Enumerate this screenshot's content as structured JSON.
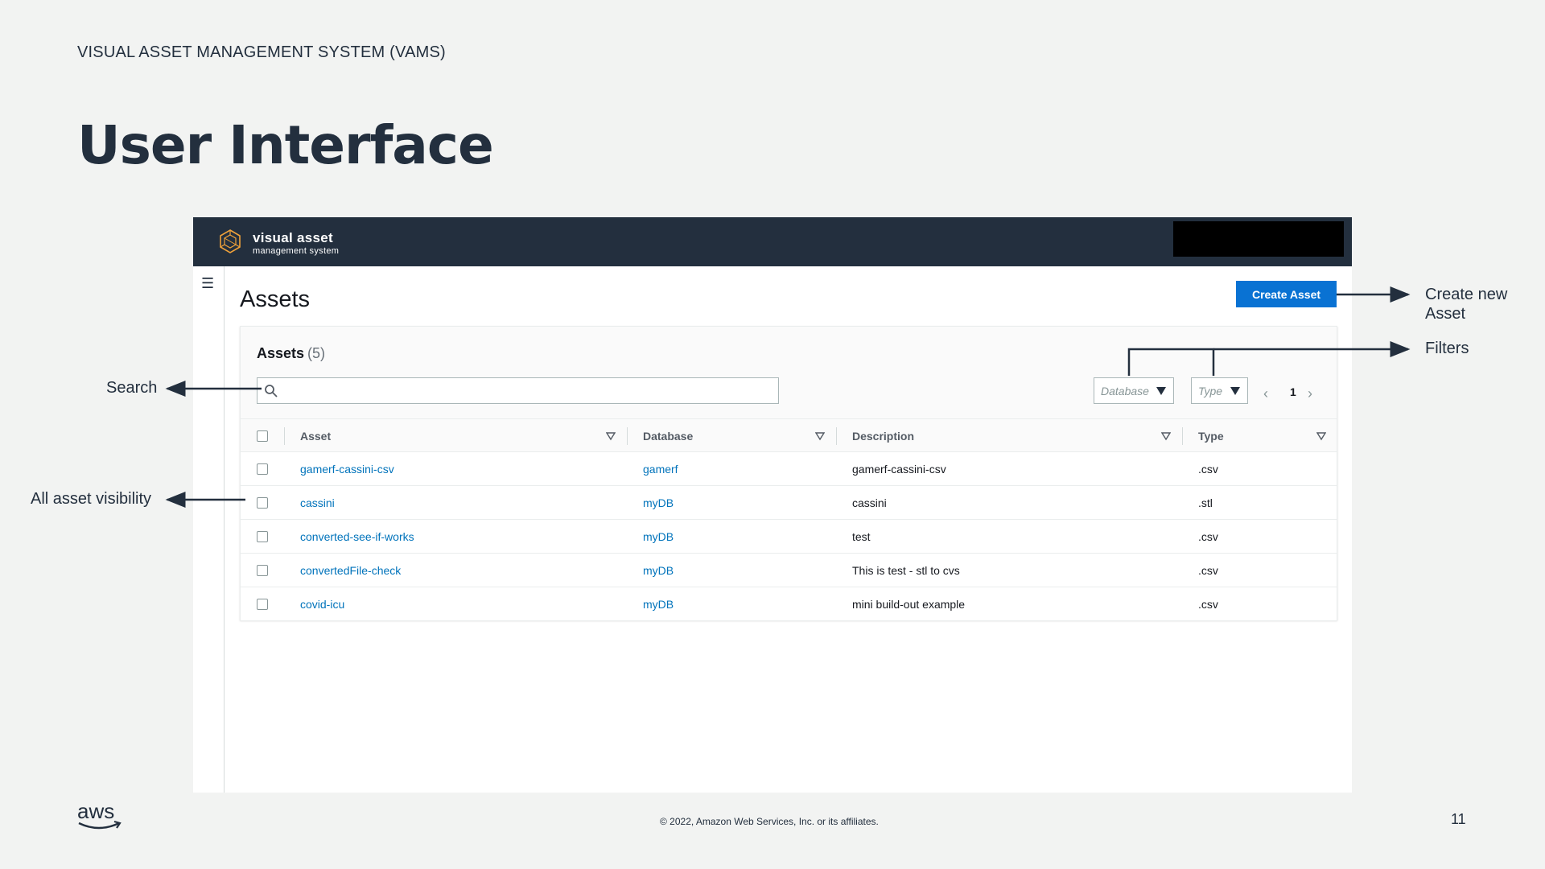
{
  "slide": {
    "subtitle": "VISUAL ASSET MANAGEMENT SYSTEM (VAMS)",
    "title": "User Interface",
    "copyright": "© 2022, Amazon Web Services, Inc. or its affiliates.",
    "page_number": "11",
    "footer_logo": "aws"
  },
  "app": {
    "logo_title": "visual asset",
    "logo_subtitle": "management system",
    "page_heading": "Assets",
    "create_button": "Create Asset",
    "panel": {
      "title": "Assets",
      "count": "(5)",
      "search_value": "",
      "filters": [
        {
          "placeholder": "Database"
        },
        {
          "placeholder": "Type"
        }
      ],
      "pagination": {
        "current_page": "1"
      }
    },
    "table": {
      "columns": [
        "Asset",
        "Database",
        "Description",
        "Type"
      ],
      "rows": [
        {
          "asset": "gamerf-cassini-csv",
          "database": "gamerf",
          "description": "gamerf-cassini-csv",
          "type": ".csv"
        },
        {
          "asset": "cassini",
          "database": "myDB",
          "description": "cassini",
          "type": ".stl"
        },
        {
          "asset": "converted-see-if-works",
          "database": "myDB",
          "description": "test",
          "type": ".csv"
        },
        {
          "asset": "convertedFile-check",
          "database": "myDB",
          "description": "This is test - stl to cvs",
          "type": ".csv"
        },
        {
          "asset": "covid-icu",
          "database": "myDB",
          "description": "mini build-out example",
          "type": ".csv"
        }
      ]
    }
  },
  "annotations": {
    "create": "Create new Asset",
    "create_line1": "Create new",
    "create_line2": "Asset",
    "filters": "Filters",
    "search": "Search",
    "visibility": "All asset visibility"
  },
  "colors": {
    "header_bg": "#232f3e",
    "primary_button": "#0972d3",
    "link": "#0073bb",
    "slide_bg": "#f2f3f2"
  }
}
